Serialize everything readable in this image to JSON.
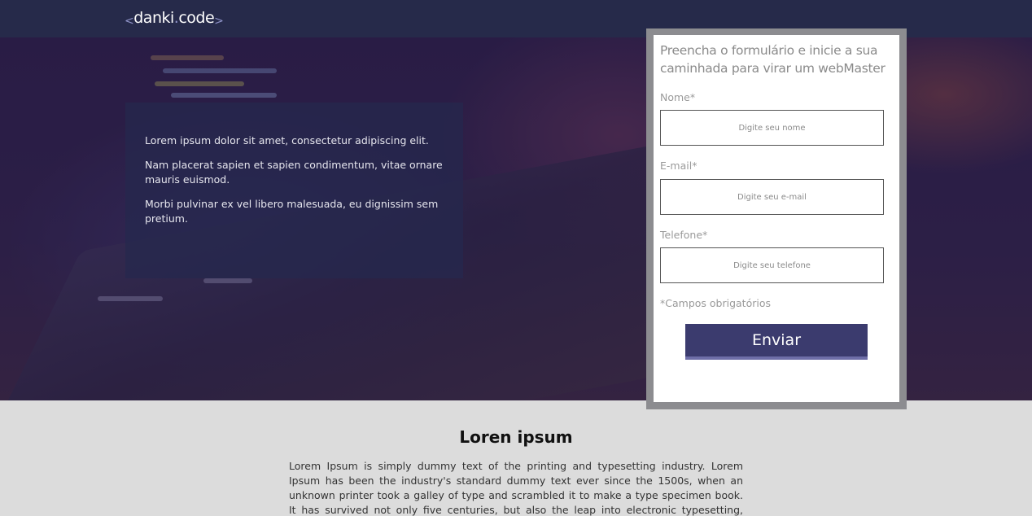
{
  "header": {
    "logo_left": "<",
    "logo_text_a": "danki",
    "logo_dot": ".",
    "logo_text_b": "code",
    "logo_right": ">"
  },
  "hero": {
    "paragraphs": [
      "Lorem ipsum dolor sit amet, consectetur adipiscing elit.",
      "Nam placerat sapien et sapien condimentum, vitae ornare mauris euismod.",
      "Morbi pulvinar ex vel libero malesuada, eu dignissim sem pretium."
    ]
  },
  "form": {
    "title": "Preencha o formulário e inicie a sua caminhada para virar um webMaster",
    "fields": [
      {
        "label": "Nome*",
        "placeholder": "Digite seu nome",
        "value": ""
      },
      {
        "label": "E-mail*",
        "placeholder": "Digite seu e-mail",
        "value": ""
      },
      {
        "label": "Telefone*",
        "placeholder": "Digite seu telefone",
        "value": ""
      }
    ],
    "required_note": "*Campos obrigatórios",
    "submit_label": "Enviar"
  },
  "section": {
    "title": "Loren ipsum",
    "body": "Lorem Ipsum is simply dummy text of the printing and typesetting industry. Lorem Ipsum has been the industry's standard dummy text ever since the 1500s, when an unknown printer took a galley of type and scrambled it to make a type specimen book. It has survived not only five centuries, but also the leap into electronic typesetting, remaining essentially unchanged. It was"
  },
  "colors": {
    "header_bg": "#262a4a",
    "button_bg": "#3b3b6e",
    "logo_accent": "#8f93c9"
  }
}
